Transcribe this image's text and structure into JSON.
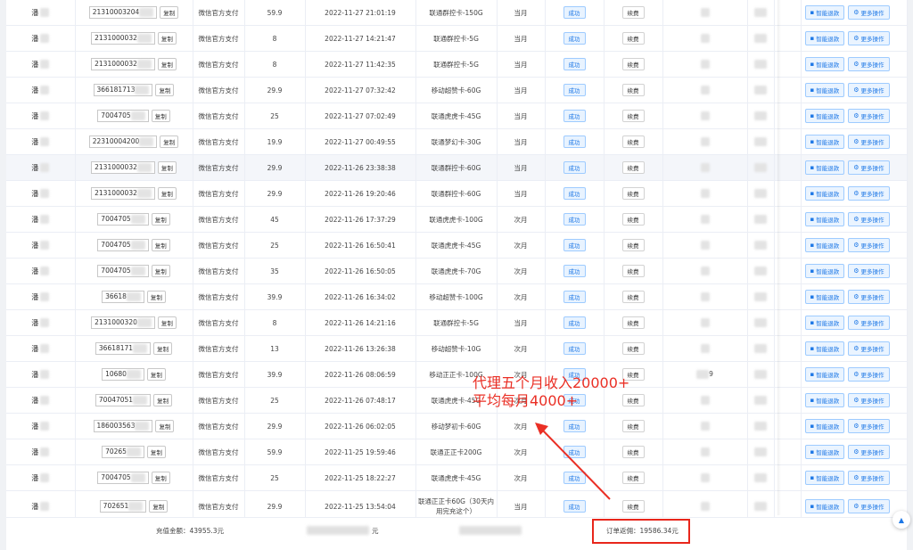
{
  "rows": [
    {
      "name": "潘",
      "id": "21310003204",
      "copy": "复制",
      "pay": "微信官方支付",
      "amount": "59.9",
      "time": "2022-11-27 21:01:19",
      "pkg": "联通群控卡-150G",
      "period": "当月",
      "status": "成功",
      "renew": "续费"
    },
    {
      "name": "潘",
      "id": "2131000032",
      "copy": "复制",
      "pay": "微信官方支付",
      "amount": "8",
      "time": "2022-11-27 14:21:47",
      "pkg": "联通群控卡-5G",
      "period": "当月",
      "status": "成功",
      "renew": "续费"
    },
    {
      "name": "潘",
      "id": "2131000032",
      "copy": "复制",
      "pay": "微信官方支付",
      "amount": "8",
      "time": "2022-11-27 11:42:35",
      "pkg": "联通群控卡-5G",
      "period": "当月",
      "status": "成功",
      "renew": "续费"
    },
    {
      "name": "潘",
      "id": "366181713",
      "copy": "复制",
      "pay": "微信官方支付",
      "amount": "29.9",
      "time": "2022-11-27 07:32:42",
      "pkg": "移动超赞卡-60G",
      "period": "当月",
      "status": "成功",
      "renew": "续费"
    },
    {
      "name": "潘",
      "id": "7004705",
      "copy": "复制",
      "pay": "微信官方支付",
      "amount": "25",
      "time": "2022-11-27 07:02:49",
      "pkg": "联通虎虎卡-45G",
      "period": "当月",
      "status": "成功",
      "renew": "续费"
    },
    {
      "name": "潘",
      "id": "22310004200",
      "copy": "复制",
      "pay": "微信官方支付",
      "amount": "19.9",
      "time": "2022-11-27 00:49:55",
      "pkg": "联通梦幻卡-30G",
      "period": "当月",
      "status": "成功",
      "renew": "续费"
    },
    {
      "name": "潘",
      "id": "2131000032",
      "copy": "复制",
      "pay": "微信官方支付",
      "amount": "29.9",
      "time": "2022-11-26 23:38:38",
      "pkg": "联通群控卡-60G",
      "period": "当月",
      "status": "成功",
      "renew": "续费"
    },
    {
      "name": "潘",
      "id": "2131000032",
      "copy": "复制",
      "pay": "微信官方支付",
      "amount": "29.9",
      "time": "2022-11-26 19:20:46",
      "pkg": "联通群控卡-60G",
      "period": "当月",
      "status": "成功",
      "renew": "续费"
    },
    {
      "name": "潘",
      "id": "7004705",
      "copy": "复制",
      "pay": "微信官方支付",
      "amount": "45",
      "time": "2022-11-26 17:37:29",
      "pkg": "联通虎虎卡-100G",
      "period": "次月",
      "status": "成功",
      "renew": "续费"
    },
    {
      "name": "潘",
      "id": "7004705",
      "copy": "复制",
      "pay": "微信官方支付",
      "amount": "25",
      "time": "2022-11-26 16:50:41",
      "pkg": "联通虎虎卡-45G",
      "period": "次月",
      "status": "成功",
      "renew": "续费"
    },
    {
      "name": "潘",
      "id": "7004705",
      "copy": "复制",
      "pay": "微信官方支付",
      "amount": "35",
      "time": "2022-11-26 16:50:05",
      "pkg": "联通虎虎卡-70G",
      "period": "次月",
      "status": "成功",
      "renew": "续费"
    },
    {
      "name": "潘",
      "id": "36618",
      "copy": "复制",
      "pay": "微信官方支付",
      "amount": "39.9",
      "time": "2022-11-26 16:34:02",
      "pkg": "移动超赞卡-100G",
      "period": "次月",
      "status": "成功",
      "renew": "续费"
    },
    {
      "name": "潘",
      "id": "2131000320",
      "copy": "复制",
      "pay": "微信官方支付",
      "amount": "8",
      "time": "2022-11-26 14:21:16",
      "pkg": "联通群控卡-5G",
      "period": "当月",
      "status": "成功",
      "renew": "续费"
    },
    {
      "name": "潘",
      "id": "36618171",
      "copy": "复制",
      "pay": "微信官方支付",
      "amount": "13",
      "time": "2022-11-26 13:26:38",
      "pkg": "移动超赞卡-10G",
      "period": "次月",
      "status": "成功",
      "renew": "续费"
    },
    {
      "name": "潘",
      "id": "10680",
      "copy": "复制",
      "pay": "微信官方支付",
      "amount": "39.9",
      "time": "2022-11-26 08:06:59",
      "pkg": "移动正正卡-100G",
      "period": "次月",
      "status": "成功",
      "renew": "续费",
      "extra": "9"
    },
    {
      "name": "潘",
      "id": "70047051",
      "copy": "复制",
      "pay": "微信官方支付",
      "amount": "25",
      "time": "2022-11-26 07:48:17",
      "pkg": "联通虎虎卡-45G",
      "period": "次月",
      "status": "成功",
      "renew": "续费"
    },
    {
      "name": "潘",
      "id": "186003563",
      "copy": "复制",
      "pay": "微信官方支付",
      "amount": "29.9",
      "time": "2022-11-26 06:02:05",
      "pkg": "移动梦初卡-60G",
      "period": "次月",
      "status": "成功",
      "renew": "续费"
    },
    {
      "name": "潘",
      "id": "70265",
      "copy": "复制",
      "pay": "微信官方支付",
      "amount": "59.9",
      "time": "2022-11-25 19:59:46",
      "pkg": "联通正正卡200G",
      "period": "次月",
      "status": "成功",
      "renew": "续费"
    },
    {
      "name": "潘",
      "id": "7004705",
      "copy": "复制",
      "pay": "微信官方支付",
      "amount": "25",
      "time": "2022-11-25 18:22:27",
      "pkg": "联通虎虎卡-45G",
      "period": "次月",
      "status": "成功",
      "renew": "续费"
    },
    {
      "name": "潘",
      "id": "702651",
      "copy": "复制",
      "pay": "微信官方支付",
      "amount": "29.9",
      "time": "2022-11-25 13:54:04",
      "pkg": "联通正正卡60G（30天内用完充这个）",
      "period": "当月",
      "status": "成功",
      "renew": "续费"
    }
  ],
  "actions": {
    "smart_refund": "智能退款",
    "more": "更多操作"
  },
  "summary": {
    "recharge_total": "充值金额：43955.3元",
    "order_rebate": "订单返佣：19586.34元",
    "hidden_suffix": "元"
  },
  "annotation": {
    "line1": "代理五个月收入20000+",
    "line2": "平均每月4000+"
  },
  "colors": {
    "accent": "#1e78e6",
    "annotation": "#ea2f25"
  }
}
